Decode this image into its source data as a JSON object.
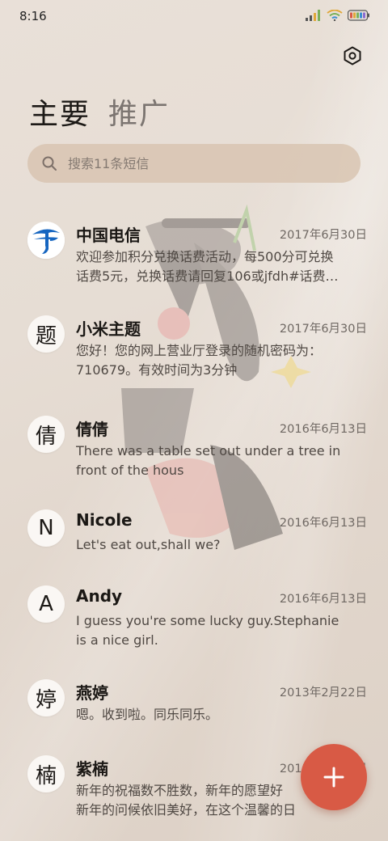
{
  "status_bar": {
    "time": "8:16"
  },
  "tabs": [
    {
      "label": "主要",
      "active": true
    },
    {
      "label": "推广",
      "active": false
    }
  ],
  "search": {
    "placeholder": "搜索11条短信"
  },
  "messages": [
    {
      "sender": "中国电信",
      "avatar": "telecom-logo",
      "date": "2017年6月30日",
      "preview_lines": [
        "欢迎参加积分兑换话费活动，每500分可兑换",
        "话费5元，兑换话费请回复106或jfdh#话费…"
      ]
    },
    {
      "sender": "小米主题",
      "avatar": "题",
      "date": "2017年6月30日",
      "preview_lines": [
        "您好！您的网上营业厅登录的随机密码为：",
        "710679。有效时间为3分钟"
      ]
    },
    {
      "sender": "倩倩",
      "avatar": "倩",
      "date": "2016年6月13日",
      "preview_lines": [
        "There was a table set out under a tree in",
        "front of the hous"
      ]
    },
    {
      "sender": "Nicole",
      "avatar": "N",
      "date": "2016年6月13日",
      "preview_lines": [
        "Let's eat out,shall we?"
      ]
    },
    {
      "sender": "Andy",
      "avatar": "A",
      "date": "2016年6月13日",
      "preview_lines": [
        "I guess you're some lucky guy.Stephanie",
        "is a nice girl."
      ]
    },
    {
      "sender": "燕婷",
      "avatar": "婷",
      "date": "2013年2月22日",
      "preview_lines": [
        "嗯。收到啦。同乐同乐。"
      ]
    },
    {
      "sender": "紫楠",
      "avatar": "楠",
      "date": "2013年2月22日",
      "preview_lines": [
        "新年的祝福数不胜数，新年的愿望好",
        "新年的问候依旧美好，在这个温馨的日"
      ]
    }
  ],
  "fab": {
    "icon": "plus-icon",
    "color": "#d85a45"
  },
  "colors": {
    "accent": "#d85a45",
    "search_bg": "#d8c4b2",
    "telecom_blue": "#1565c0"
  }
}
